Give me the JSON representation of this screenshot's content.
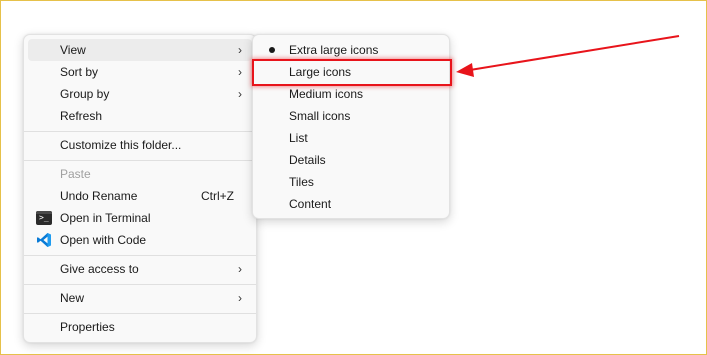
{
  "context_menu": {
    "items": [
      {
        "label": "View",
        "submenu": true
      },
      {
        "label": "Sort by",
        "submenu": true
      },
      {
        "label": "Group by",
        "submenu": true
      },
      {
        "label": "Refresh"
      },
      {
        "label": "Customize this folder..."
      },
      {
        "label": "Paste",
        "disabled": true
      },
      {
        "label": "Undo Rename",
        "shortcut": "Ctrl+Z"
      },
      {
        "label": "Open in Terminal",
        "icon": "terminal-icon"
      },
      {
        "label": "Open with Code",
        "icon": "vscode-icon"
      },
      {
        "label": "Give access to",
        "submenu": true
      },
      {
        "label": "New",
        "submenu": true
      },
      {
        "label": "Properties"
      }
    ]
  },
  "view_submenu": {
    "selected": "Extra large icons",
    "items": [
      {
        "label": "Extra large icons"
      },
      {
        "label": "Large icons"
      },
      {
        "label": "Medium icons"
      },
      {
        "label": "Small icons"
      },
      {
        "label": "List"
      },
      {
        "label": "Details"
      },
      {
        "label": "Tiles"
      },
      {
        "label": "Content"
      }
    ]
  },
  "annotation": {
    "highlight_color": "#e8141b",
    "target": "Large icons"
  },
  "icons": {
    "submenu_chevron": "chevron-right-icon",
    "selected_marker": "bullet-icon"
  }
}
